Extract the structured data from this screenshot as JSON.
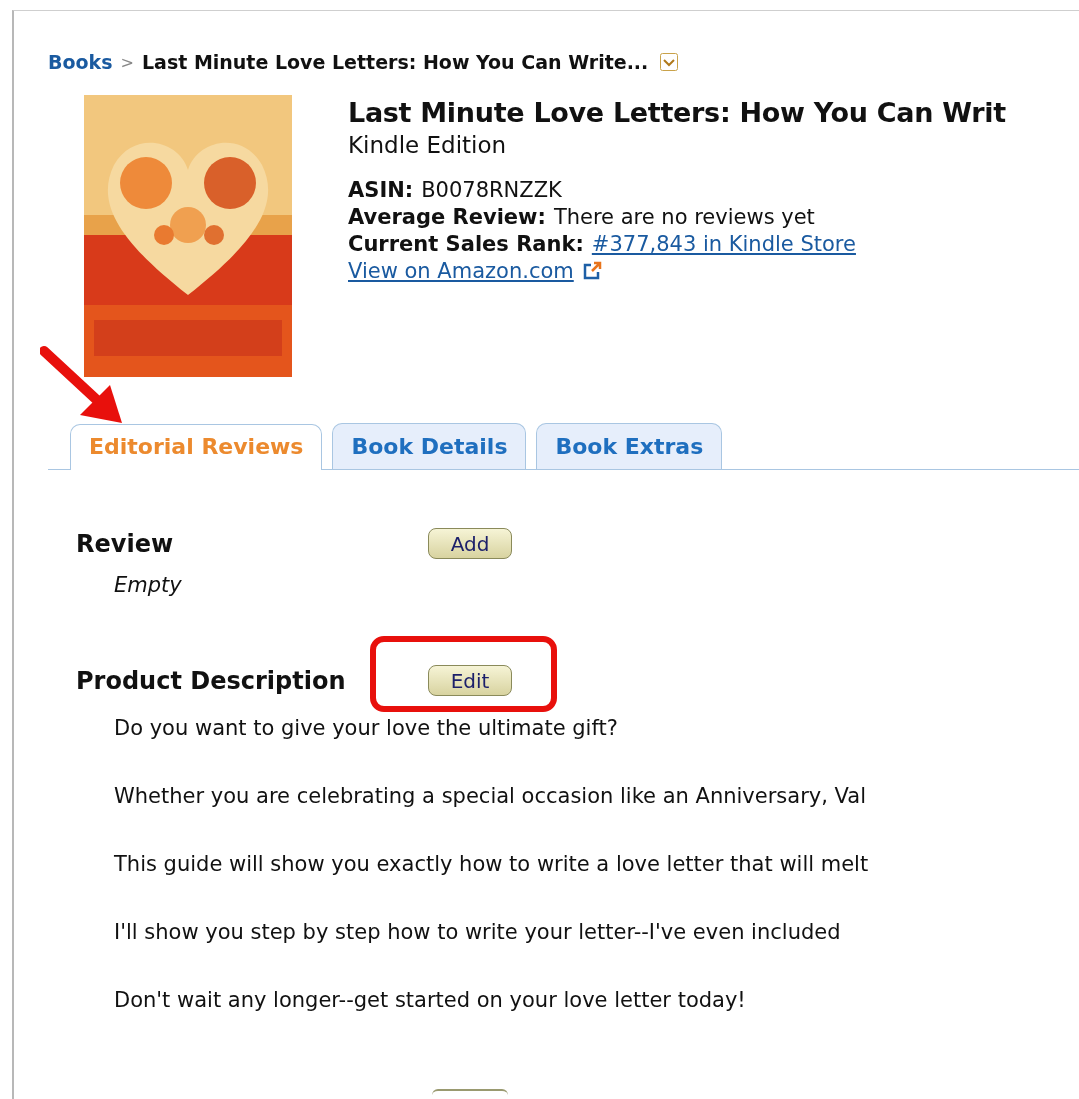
{
  "breadcrumb": {
    "category": "Books",
    "separator": ">",
    "current": "Last Minute Love Letters: How You Can Write..."
  },
  "product": {
    "title": "Last Minute Love Letters: How You Can Writ",
    "edition": "Kindle Edition",
    "facts": [
      {
        "label": "ASIN:",
        "value": "B0078RNZZK",
        "kind": "text"
      },
      {
        "label": "Average Review:",
        "value": "There are no reviews yet",
        "kind": "text"
      },
      {
        "label": "Current Sales Rank:",
        "value": "#377,843 in Kindle Store",
        "kind": "link"
      }
    ],
    "amazon_link": "View on Amazon.com"
  },
  "tabs": [
    {
      "label": "Editorial Reviews",
      "selected": true
    },
    {
      "label": "Book Details",
      "selected": false
    },
    {
      "label": "Book Extras",
      "selected": false
    }
  ],
  "sections": [
    {
      "heading": "Review",
      "button": "Add",
      "empty": "Empty"
    },
    {
      "heading": "Product Description",
      "button": "Edit",
      "paragraphs": [
        "Do you want to give your love the ultimate gift?",
        "Whether you are celebrating a special occasion like an Anniversary, Val",
        "This guide will show you exactly how to write a love letter that will melt",
        "I'll show you step by step how to write your letter--I've even included",
        "Don't wait any longer--get started on your love letter today!"
      ]
    }
  ]
}
